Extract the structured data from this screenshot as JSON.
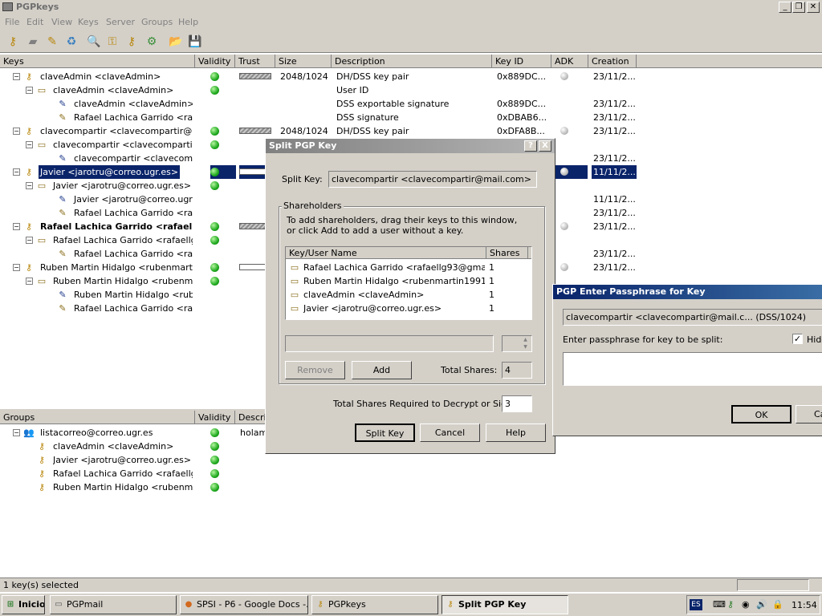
{
  "window": {
    "title": "PGPkeys"
  },
  "menu": [
    "File",
    "Edit",
    "View",
    "Keys",
    "Server",
    "Groups",
    "Help"
  ],
  "keys_table": {
    "columns": [
      "Keys",
      "Validity",
      "Trust",
      "Size",
      "Description",
      "Key ID",
      "ADK",
      "Creation"
    ],
    "rows": [
      {
        "name": "claveAdmin <claveAdmin>",
        "bold": false,
        "size": "2048/1024",
        "desc": "DH/DSS key pair",
        "keyid": "0x889DC...",
        "creation": "23/11/2..."
      },
      {
        "name": "claveAdmin <claveAdmin>",
        "bold": false,
        "size": "",
        "desc": "User ID",
        "keyid": "",
        "creation": ""
      },
      {
        "name": "claveAdmin <claveAdmin>",
        "bold": false,
        "size": "",
        "desc": "DSS exportable signature",
        "keyid": "0x889DC...",
        "creation": "23/11/2..."
      },
      {
        "name": "Rafael Lachica Garrido <rafaell...",
        "bold": false,
        "size": "",
        "desc": "DSS signature",
        "keyid": "0xDBAB6...",
        "creation": "23/11/2..."
      },
      {
        "name": "clavecompartir <clavecompartir@mail....",
        "bold": false,
        "size": "2048/1024",
        "desc": "DH/DSS key pair",
        "keyid": "0xDFA8B...",
        "creation": "23/11/2..."
      },
      {
        "name": "clavecompartir <clavecompartir@...",
        "bold": false,
        "size": "",
        "desc": "",
        "keyid": "",
        "creation": ""
      },
      {
        "name": "clavecompartir <clavecompartir...",
        "bold": false,
        "size": "",
        "desc": "",
        "keyid": "",
        "creation": "23/11/2..."
      },
      {
        "name": "Javier <jarotru@correo.ugr.es>",
        "bold": false,
        "size": "",
        "desc": "",
        "keyid": "",
        "creation": "11/11/2..."
      },
      {
        "name": "Javier <jarotru@correo.ugr.es>",
        "bold": false,
        "size": "",
        "desc": "",
        "keyid": "",
        "creation": ""
      },
      {
        "name": "Javier <jarotru@correo.ugr.es>",
        "bold": false,
        "size": "",
        "desc": "",
        "keyid": "",
        "creation": "11/11/2..."
      },
      {
        "name": "Rafael Lachica Garrido <rafaell...",
        "bold": false,
        "size": "",
        "desc": "",
        "keyid": "",
        "creation": "23/11/2..."
      },
      {
        "name": "Rafael Lachica Garrido <rafaell...",
        "bold": true,
        "size": "",
        "desc": "",
        "keyid": "",
        "creation": "23/11/2..."
      },
      {
        "name": "Rafael Lachica Garrido <rafaellg93...",
        "bold": false,
        "size": "",
        "desc": "",
        "keyid": "",
        "creation": ""
      },
      {
        "name": "Rafael Lachica Garrido <rafaell...",
        "bold": false,
        "size": "",
        "desc": "",
        "keyid": "",
        "creation": "23/11/2..."
      },
      {
        "name": "Ruben Martin Hidalgo <rubenmartin19...",
        "bold": false,
        "size": "",
        "desc": "",
        "keyid": "",
        "creation": "23/11/2..."
      },
      {
        "name": "Ruben Martin Hidalgo <rubenmarti...",
        "bold": false,
        "size": "",
        "desc": "",
        "keyid": "",
        "creation": ""
      },
      {
        "name": "Ruben Martin Hidalgo <rubenm...",
        "bold": false,
        "size": "",
        "desc": "",
        "keyid": "",
        "creation": ""
      },
      {
        "name": "Rafael Lachica Garrido <rafaell...",
        "bold": false,
        "size": "",
        "desc": "",
        "keyid": "",
        "creation": ""
      }
    ]
  },
  "groups_table": {
    "columns": [
      "Groups",
      "Validity",
      "Descri"
    ],
    "rows": [
      {
        "name": "listacorreo@correo.ugr.es",
        "desc": "holamu"
      },
      {
        "name": "claveAdmin <claveAdmin>",
        "desc": ""
      },
      {
        "name": "Javier <jarotru@correo.ugr.es>",
        "desc": ""
      },
      {
        "name": "Rafael Lachica Garrido <rafaellg93...",
        "desc": ""
      },
      {
        "name": "Ruben Martin Hidalgo <rubenmarti...",
        "desc": ""
      }
    ]
  },
  "split_dialog": {
    "title": "Split PGP Key",
    "help_btn": "?",
    "close_btn": "X",
    "split_key_label": "Split Key:",
    "split_key_value": "clavecompartir <clavecompartir@mail.com>",
    "shareholders_label": "Shareholders",
    "instructions": "To add shareholders, drag their keys to this window, or click Add to add a user without a key.",
    "list_columns": [
      "Key/User Name",
      "Shares"
    ],
    "shareholders": [
      {
        "name": "Rafael Lachica Garrido <rafaellg93@gmail.c...",
        "shares": "1"
      },
      {
        "name": "Ruben Martin Hidalgo <rubenmartin1991@...",
        "shares": "1"
      },
      {
        "name": "claveAdmin <claveAdmin>",
        "shares": "1"
      },
      {
        "name": "Javier <jarotru@correo.ugr.es>",
        "shares": "1"
      }
    ],
    "remove_btn": "Remove",
    "add_btn": "Add",
    "total_shares_label": "Total Shares:",
    "total_shares_value": "4",
    "required_label": "Total Shares Required to Decrypt or Sign:",
    "required_value": "3",
    "split_btn": "Split Key",
    "cancel_btn": "Cancel",
    "help_button": "Help"
  },
  "pass_dialog": {
    "title": "PGP Enter Passphrase for Key",
    "key_value": "clavecompartir <clavecompartir@mail.c...   (DSS/1024)",
    "prompt": "Enter passphrase for key to be split:",
    "hide_label": "Hide",
    "ok_btn": "OK",
    "cancel_btn": "Ca"
  },
  "status": {
    "text": "1 key(s) selected"
  },
  "taskbar": {
    "start": "Inicio",
    "tasks": [
      "PGPmail",
      "SPSI - P6 - Google Docs -...",
      "PGPkeys",
      "Split PGP Key"
    ],
    "lang": "ES",
    "clock": "11:54"
  },
  "colors": {
    "selection": "#0a246a",
    "titlebar_active": "#0a246a",
    "face": "#d4d0c8"
  }
}
